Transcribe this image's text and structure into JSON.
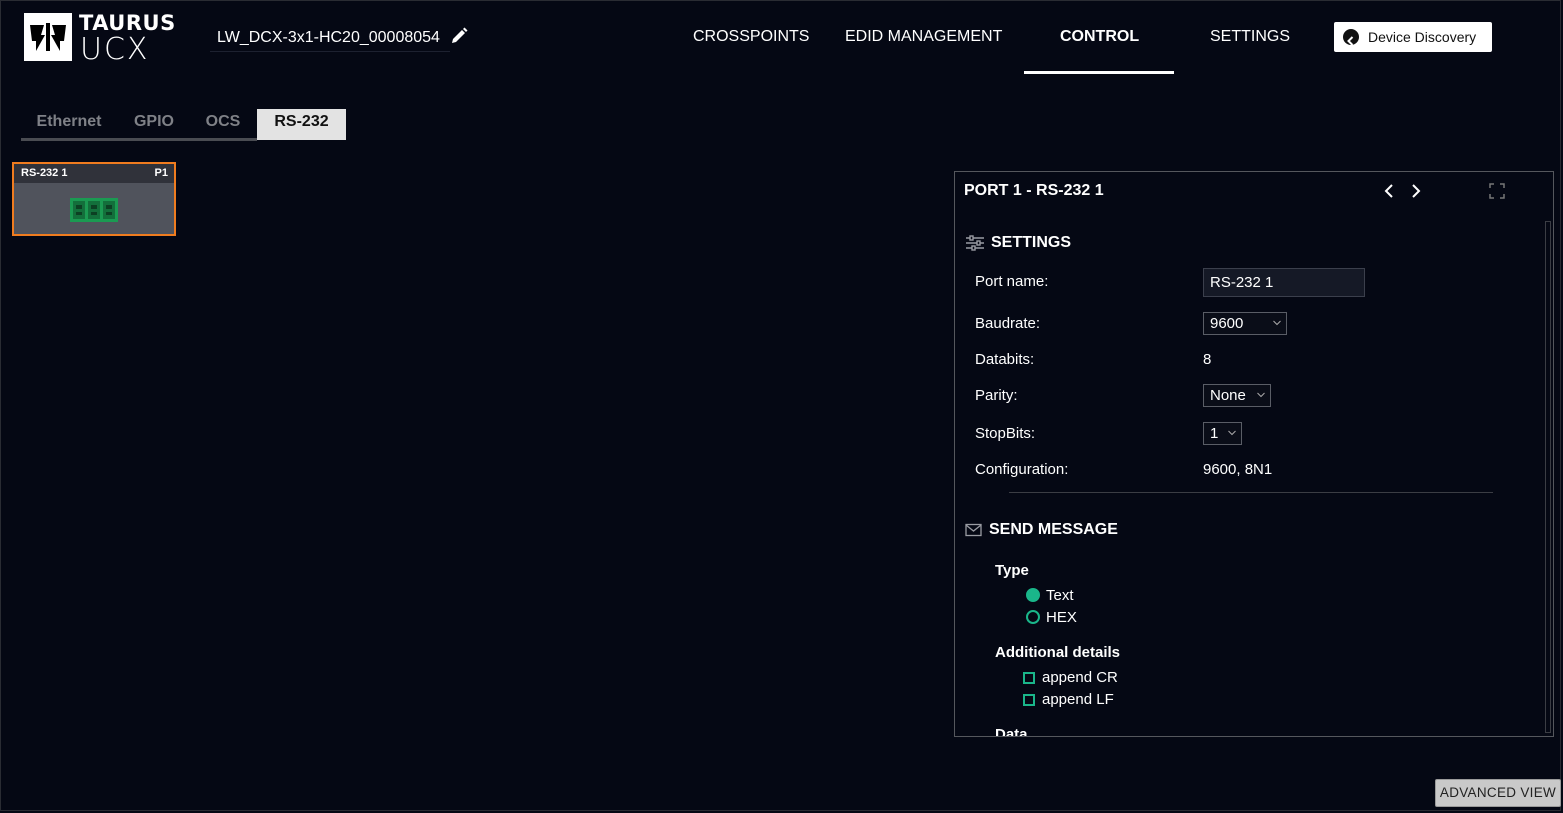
{
  "app": {
    "logo_line1": "TAURUS",
    "logo_line2": "UCX",
    "device_name": "LW_DCX-3x1-HC20_00008054"
  },
  "nav": {
    "items": [
      "CROSSPOINTS",
      "EDID MANAGEMENT",
      "CONTROL",
      "SETTINGS"
    ],
    "active": "CONTROL",
    "discovery_label": "Device Discovery"
  },
  "tabs": {
    "items": [
      "Ethernet",
      "GPIO",
      "OCS",
      "RS-232"
    ],
    "active": "RS-232"
  },
  "port_card": {
    "label": "RS-232 1",
    "port": "P1"
  },
  "panel": {
    "title": "PORT 1 - RS-232 1",
    "settings": {
      "heading": "SETTINGS",
      "port_name_label": "Port name:",
      "port_name_value": "RS-232 1",
      "baudrate_label": "Baudrate:",
      "baudrate_value": "9600",
      "databits_label": "Databits:",
      "databits_value": "8",
      "parity_label": "Parity:",
      "parity_value": "None",
      "stopbits_label": "StopBits:",
      "stopbits_value": "1",
      "configuration_label": "Configuration:",
      "configuration_value": "9600, 8N1"
    },
    "send_message": {
      "heading": "SEND MESSAGE",
      "type_label": "Type",
      "type_options": [
        "Text",
        "HEX"
      ],
      "type_selected": "Text",
      "additional_label": "Additional details",
      "append_cr": "append CR",
      "append_lf": "append LF",
      "data_label": "Data"
    }
  },
  "footer": {
    "advanced_view": "ADVANCED VIEW"
  },
  "colors": {
    "background": "#050814",
    "accent_orange": "#f07c1f",
    "accent_green": "#1ab68a",
    "connector_green": "#1b9a52"
  }
}
